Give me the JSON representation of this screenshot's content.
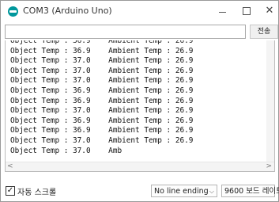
{
  "window": {
    "title": "COM3 (Arduino Uno)",
    "minimize_icon": "minimize-icon",
    "maximize_icon": "maximize-icon",
    "close_label": "✕"
  },
  "send": {
    "input_value": "",
    "button_label": "전송"
  },
  "output_lines": [
    "Object Temp : 36.9    Ambient Temp : 26.9",
    "Object Temp : 36.9    Ambient Temp : 26.9",
    "Object Temp : 37.0    Ambient Temp : 26.9",
    "Object Temp : 37.0    Ambient Temp : 26.9",
    "Object Temp : 37.0    Ambient Temp : 26.9",
    "Object Temp : 36.9    Ambient Temp : 26.9",
    "Object Temp : 36.9    Ambient Temp : 26.9",
    "Object Temp : 37.0    Ambient Temp : 26.9",
    "Object Temp : 36.9    Ambient Temp : 26.9",
    "Object Temp : 36.9    Ambient Temp : 26.9",
    "Object Temp : 37.0    Ambient Temp : 26.9",
    "Object Temp : 37.0    Amb"
  ],
  "scroll": {
    "left_arrow": "<",
    "right_arrow": ">"
  },
  "status": {
    "autoscroll_checked": "✓",
    "autoscroll_label": "자동 스크롤",
    "line_ending": "No line ending",
    "baud": "9600 보드 레이트",
    "chevron": "⌵"
  },
  "colors": {
    "accent": "#00979c"
  }
}
